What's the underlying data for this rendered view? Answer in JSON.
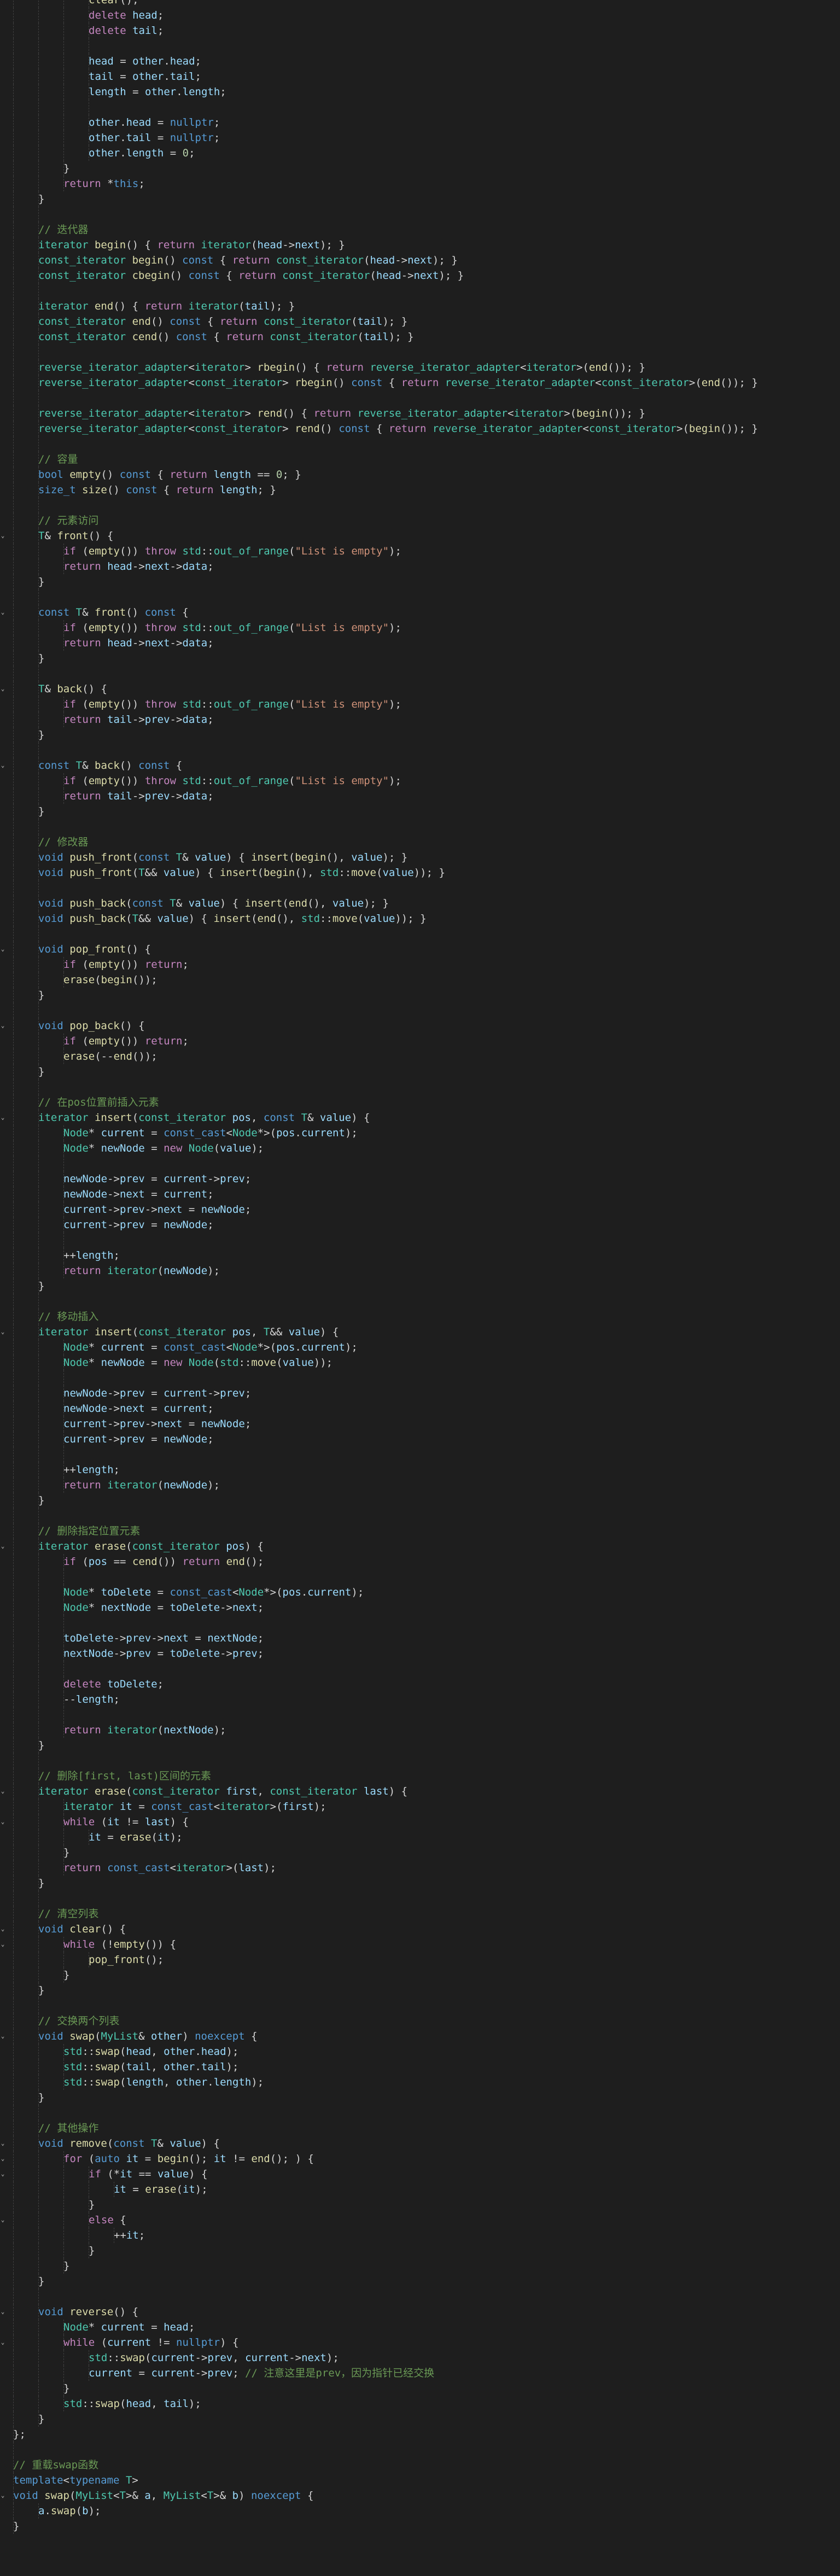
{
  "editor": {
    "language": "cpp",
    "colors": {
      "background": "#1e1e1e",
      "keyword": "#569cd6",
      "control": "#c586c0",
      "type": "#4ec9b0",
      "function": "#dcdcaa",
      "variable": "#9cdcfe",
      "string": "#ce9178",
      "number": "#b5cea8",
      "comment": "#6a9955",
      "text": "#d4d4d4"
    },
    "lines": [
      {
        "indent": 4,
        "fold": "",
        "text": "clear();"
      },
      {
        "indent": 4,
        "fold": "",
        "text": "delete head;"
      },
      {
        "indent": 4,
        "fold": "",
        "text": "delete tail;"
      },
      {
        "indent": 4,
        "fold": "",
        "text": ""
      },
      {
        "indent": 4,
        "fold": "",
        "text": "head = other.head;"
      },
      {
        "indent": 4,
        "fold": "",
        "text": "tail = other.tail;"
      },
      {
        "indent": 4,
        "fold": "",
        "text": "length = other.length;"
      },
      {
        "indent": 4,
        "fold": "",
        "text": ""
      },
      {
        "indent": 4,
        "fold": "",
        "text": "other.head = nullptr;"
      },
      {
        "indent": 4,
        "fold": "",
        "text": "other.tail = nullptr;"
      },
      {
        "indent": 4,
        "fold": "",
        "text": "other.length = 0;"
      },
      {
        "indent": 3,
        "fold": "",
        "text": "}"
      },
      {
        "indent": 3,
        "fold": "",
        "text": "return *this;"
      },
      {
        "indent": 2,
        "fold": "",
        "text": "}"
      },
      {
        "indent": 2,
        "fold": "",
        "text": ""
      },
      {
        "indent": 2,
        "fold": "",
        "text": "// 迭代器"
      },
      {
        "indent": 2,
        "fold": "",
        "text": "iterator begin() { return iterator(head->next); }"
      },
      {
        "indent": 2,
        "fold": "",
        "text": "const_iterator begin() const { return const_iterator(head->next); }"
      },
      {
        "indent": 2,
        "fold": "",
        "text": "const_iterator cbegin() const { return const_iterator(head->next); }"
      },
      {
        "indent": 2,
        "fold": "",
        "text": ""
      },
      {
        "indent": 2,
        "fold": "",
        "text": "iterator end() { return iterator(tail); }"
      },
      {
        "indent": 2,
        "fold": "",
        "text": "const_iterator end() const { return const_iterator(tail); }"
      },
      {
        "indent": 2,
        "fold": "",
        "text": "const_iterator cend() const { return const_iterator(tail); }"
      },
      {
        "indent": 2,
        "fold": "",
        "text": ""
      },
      {
        "indent": 2,
        "fold": "",
        "text": "reverse_iterator_adapter<iterator> rbegin() { return reverse_iterator_adapter<iterator>(end()); }"
      },
      {
        "indent": 2,
        "fold": "",
        "text": "reverse_iterator_adapter<const_iterator> rbegin() const { return reverse_iterator_adapter<const_iterator>(end()); }"
      },
      {
        "indent": 2,
        "fold": "",
        "text": ""
      },
      {
        "indent": 2,
        "fold": "",
        "text": "reverse_iterator_adapter<iterator> rend() { return reverse_iterator_adapter<iterator>(begin()); }"
      },
      {
        "indent": 2,
        "fold": "",
        "text": "reverse_iterator_adapter<const_iterator> rend() const { return reverse_iterator_adapter<const_iterator>(begin()); }"
      },
      {
        "indent": 2,
        "fold": "",
        "text": ""
      },
      {
        "indent": 2,
        "fold": "",
        "text": "// 容量"
      },
      {
        "indent": 2,
        "fold": "",
        "text": "bool empty() const { return length == 0; }"
      },
      {
        "indent": 2,
        "fold": "",
        "text": "size_t size() const { return length; }"
      },
      {
        "indent": 2,
        "fold": "",
        "text": ""
      },
      {
        "indent": 2,
        "fold": "",
        "text": "// 元素访问"
      },
      {
        "indent": 2,
        "fold": "⌄",
        "text": "T& front() {"
      },
      {
        "indent": 3,
        "fold": "",
        "text": "if (empty()) throw std::out_of_range(\"List is empty\");"
      },
      {
        "indent": 3,
        "fold": "",
        "text": "return head->next->data;"
      },
      {
        "indent": 2,
        "fold": "",
        "text": "}"
      },
      {
        "indent": 2,
        "fold": "",
        "text": ""
      },
      {
        "indent": 2,
        "fold": "⌄",
        "text": "const T& front() const {"
      },
      {
        "indent": 3,
        "fold": "",
        "text": "if (empty()) throw std::out_of_range(\"List is empty\");"
      },
      {
        "indent": 3,
        "fold": "",
        "text": "return head->next->data;"
      },
      {
        "indent": 2,
        "fold": "",
        "text": "}"
      },
      {
        "indent": 2,
        "fold": "",
        "text": ""
      },
      {
        "indent": 2,
        "fold": "⌄",
        "text": "T& back() {"
      },
      {
        "indent": 3,
        "fold": "",
        "text": "if (empty()) throw std::out_of_range(\"List is empty\");"
      },
      {
        "indent": 3,
        "fold": "",
        "text": "return tail->prev->data;"
      },
      {
        "indent": 2,
        "fold": "",
        "text": "}"
      },
      {
        "indent": 2,
        "fold": "",
        "text": ""
      },
      {
        "indent": 2,
        "fold": "⌄",
        "text": "const T& back() const {"
      },
      {
        "indent": 3,
        "fold": "",
        "text": "if (empty()) throw std::out_of_range(\"List is empty\");"
      },
      {
        "indent": 3,
        "fold": "",
        "text": "return tail->prev->data;"
      },
      {
        "indent": 2,
        "fold": "",
        "text": "}"
      },
      {
        "indent": 2,
        "fold": "",
        "text": ""
      },
      {
        "indent": 2,
        "fold": "",
        "text": "// 修改器"
      },
      {
        "indent": 2,
        "fold": "",
        "text": "void push_front(const T& value) { insert(begin(), value); }"
      },
      {
        "indent": 2,
        "fold": "",
        "text": "void push_front(T&& value) { insert(begin(), std::move(value)); }"
      },
      {
        "indent": 2,
        "fold": "",
        "text": ""
      },
      {
        "indent": 2,
        "fold": "",
        "text": "void push_back(const T& value) { insert(end(), value); }"
      },
      {
        "indent": 2,
        "fold": "",
        "text": "void push_back(T&& value) { insert(end(), std::move(value)); }"
      },
      {
        "indent": 2,
        "fold": "",
        "text": ""
      },
      {
        "indent": 2,
        "fold": "⌄",
        "text": "void pop_front() {"
      },
      {
        "indent": 3,
        "fold": "",
        "text": "if (empty()) return;"
      },
      {
        "indent": 3,
        "fold": "",
        "text": "erase(begin());"
      },
      {
        "indent": 2,
        "fold": "",
        "text": "}"
      },
      {
        "indent": 2,
        "fold": "",
        "text": ""
      },
      {
        "indent": 2,
        "fold": "⌄",
        "text": "void pop_back() {"
      },
      {
        "indent": 3,
        "fold": "",
        "text": "if (empty()) return;"
      },
      {
        "indent": 3,
        "fold": "",
        "text": "erase(--end());"
      },
      {
        "indent": 2,
        "fold": "",
        "text": "}"
      },
      {
        "indent": 2,
        "fold": "",
        "text": ""
      },
      {
        "indent": 2,
        "fold": "",
        "text": "// 在pos位置前插入元素"
      },
      {
        "indent": 2,
        "fold": "⌄",
        "text": "iterator insert(const_iterator pos, const T& value) {"
      },
      {
        "indent": 3,
        "fold": "",
        "text": "Node* current = const_cast<Node*>(pos.current);"
      },
      {
        "indent": 3,
        "fold": "",
        "text": "Node* newNode = new Node(value);"
      },
      {
        "indent": 3,
        "fold": "",
        "text": ""
      },
      {
        "indent": 3,
        "fold": "",
        "text": "newNode->prev = current->prev;"
      },
      {
        "indent": 3,
        "fold": "",
        "text": "newNode->next = current;"
      },
      {
        "indent": 3,
        "fold": "",
        "text": "current->prev->next = newNode;"
      },
      {
        "indent": 3,
        "fold": "",
        "text": "current->prev = newNode;"
      },
      {
        "indent": 3,
        "fold": "",
        "text": ""
      },
      {
        "indent": 3,
        "fold": "",
        "text": "++length;"
      },
      {
        "indent": 3,
        "fold": "",
        "text": "return iterator(newNode);"
      },
      {
        "indent": 2,
        "fold": "",
        "text": "}"
      },
      {
        "indent": 2,
        "fold": "",
        "text": ""
      },
      {
        "indent": 2,
        "fold": "",
        "text": "// 移动插入"
      },
      {
        "indent": 2,
        "fold": "⌄",
        "text": "iterator insert(const_iterator pos, T&& value) {"
      },
      {
        "indent": 3,
        "fold": "",
        "text": "Node* current = const_cast<Node*>(pos.current);"
      },
      {
        "indent": 3,
        "fold": "",
        "text": "Node* newNode = new Node(std::move(value));"
      },
      {
        "indent": 3,
        "fold": "",
        "text": ""
      },
      {
        "indent": 3,
        "fold": "",
        "text": "newNode->prev = current->prev;"
      },
      {
        "indent": 3,
        "fold": "",
        "text": "newNode->next = current;"
      },
      {
        "indent": 3,
        "fold": "",
        "text": "current->prev->next = newNode;"
      },
      {
        "indent": 3,
        "fold": "",
        "text": "current->prev = newNode;"
      },
      {
        "indent": 3,
        "fold": "",
        "text": ""
      },
      {
        "indent": 3,
        "fold": "",
        "text": "++length;"
      },
      {
        "indent": 3,
        "fold": "",
        "text": "return iterator(newNode);"
      },
      {
        "indent": 2,
        "fold": "",
        "text": "}"
      },
      {
        "indent": 2,
        "fold": "",
        "text": ""
      },
      {
        "indent": 2,
        "fold": "",
        "text": "// 删除指定位置元素"
      },
      {
        "indent": 2,
        "fold": "⌄",
        "text": "iterator erase(const_iterator pos) {"
      },
      {
        "indent": 3,
        "fold": "",
        "text": "if (pos == cend()) return end();"
      },
      {
        "indent": 3,
        "fold": "",
        "text": ""
      },
      {
        "indent": 3,
        "fold": "",
        "text": "Node* toDelete = const_cast<Node*>(pos.current);"
      },
      {
        "indent": 3,
        "fold": "",
        "text": "Node* nextNode = toDelete->next;"
      },
      {
        "indent": 3,
        "fold": "",
        "text": ""
      },
      {
        "indent": 3,
        "fold": "",
        "text": "toDelete->prev->next = nextNode;"
      },
      {
        "indent": 3,
        "fold": "",
        "text": "nextNode->prev = toDelete->prev;"
      },
      {
        "indent": 3,
        "fold": "",
        "text": ""
      },
      {
        "indent": 3,
        "fold": "",
        "text": "delete toDelete;"
      },
      {
        "indent": 3,
        "fold": "",
        "text": "--length;"
      },
      {
        "indent": 3,
        "fold": "",
        "text": ""
      },
      {
        "indent": 3,
        "fold": "",
        "text": "return iterator(nextNode);"
      },
      {
        "indent": 2,
        "fold": "",
        "text": "}"
      },
      {
        "indent": 2,
        "fold": "",
        "text": ""
      },
      {
        "indent": 2,
        "fold": "",
        "text": "// 删除[first, last)区间的元素"
      },
      {
        "indent": 2,
        "fold": "⌄",
        "text": "iterator erase(const_iterator first, const_iterator last) {"
      },
      {
        "indent": 3,
        "fold": "",
        "text": "iterator it = const_cast<iterator>(first);"
      },
      {
        "indent": 3,
        "fold": "⌄",
        "text": "while (it != last) {"
      },
      {
        "indent": 4,
        "fold": "",
        "text": "it = erase(it);"
      },
      {
        "indent": 3,
        "fold": "",
        "text": "}"
      },
      {
        "indent": 3,
        "fold": "",
        "text": "return const_cast<iterator>(last);"
      },
      {
        "indent": 2,
        "fold": "",
        "text": "}"
      },
      {
        "indent": 2,
        "fold": "",
        "text": ""
      },
      {
        "indent": 2,
        "fold": "",
        "text": "// 清空列表"
      },
      {
        "indent": 2,
        "fold": "⌄",
        "text": "void clear() {"
      },
      {
        "indent": 3,
        "fold": "⌄",
        "text": "while (!empty()) {"
      },
      {
        "indent": 4,
        "fold": "",
        "text": "pop_front();"
      },
      {
        "indent": 3,
        "fold": "",
        "text": "}"
      },
      {
        "indent": 2,
        "fold": "",
        "text": "}"
      },
      {
        "indent": 2,
        "fold": "",
        "text": ""
      },
      {
        "indent": 2,
        "fold": "",
        "text": "// 交换两个列表"
      },
      {
        "indent": 2,
        "fold": "⌄",
        "text": "void swap(MyList& other) noexcept {"
      },
      {
        "indent": 3,
        "fold": "",
        "text": "std::swap(head, other.head);"
      },
      {
        "indent": 3,
        "fold": "",
        "text": "std::swap(tail, other.tail);"
      },
      {
        "indent": 3,
        "fold": "",
        "text": "std::swap(length, other.length);"
      },
      {
        "indent": 2,
        "fold": "",
        "text": "}"
      },
      {
        "indent": 2,
        "fold": "",
        "text": ""
      },
      {
        "indent": 2,
        "fold": "",
        "text": "// 其他操作"
      },
      {
        "indent": 2,
        "fold": "⌄",
        "text": "void remove(const T& value) {"
      },
      {
        "indent": 3,
        "fold": "⌄",
        "text": "for (auto it = begin(); it != end(); ) {"
      },
      {
        "indent": 4,
        "fold": "⌄",
        "text": "if (*it == value) {"
      },
      {
        "indent": 5,
        "fold": "",
        "text": "it = erase(it);"
      },
      {
        "indent": 4,
        "fold": "",
        "text": "}"
      },
      {
        "indent": 4,
        "fold": "⌄",
        "text": "else {"
      },
      {
        "indent": 5,
        "fold": "",
        "text": "++it;"
      },
      {
        "indent": 4,
        "fold": "",
        "text": "}"
      },
      {
        "indent": 3,
        "fold": "",
        "text": "}"
      },
      {
        "indent": 2,
        "fold": "",
        "text": "}"
      },
      {
        "indent": 2,
        "fold": "",
        "text": ""
      },
      {
        "indent": 2,
        "fold": "⌄",
        "text": "void reverse() {"
      },
      {
        "indent": 3,
        "fold": "",
        "text": "Node* current = head;"
      },
      {
        "indent": 3,
        "fold": "⌄",
        "text": "while (current != nullptr) {"
      },
      {
        "indent": 4,
        "fold": "",
        "text": "std::swap(current->prev, current->next);"
      },
      {
        "indent": 4,
        "fold": "",
        "text": "current = current->prev; // 注意这里是prev，因为指针已经交换"
      },
      {
        "indent": 3,
        "fold": "",
        "text": "}"
      },
      {
        "indent": 3,
        "fold": "",
        "text": "std::swap(head, tail);"
      },
      {
        "indent": 2,
        "fold": "",
        "text": "}"
      },
      {
        "indent": 1,
        "fold": "",
        "text": "};"
      },
      {
        "indent": 1,
        "fold": "",
        "text": ""
      },
      {
        "indent": 1,
        "fold": "",
        "text": "// 重载swap函数"
      },
      {
        "indent": 1,
        "fold": "",
        "text": "template<typename T>"
      },
      {
        "indent": 1,
        "fold": "⌄",
        "text": "void swap(MyList<T>& a, MyList<T>& b) noexcept {"
      },
      {
        "indent": 2,
        "fold": "",
        "text": "a.swap(b);"
      },
      {
        "indent": 1,
        "fold": "",
        "text": "}"
      }
    ]
  }
}
